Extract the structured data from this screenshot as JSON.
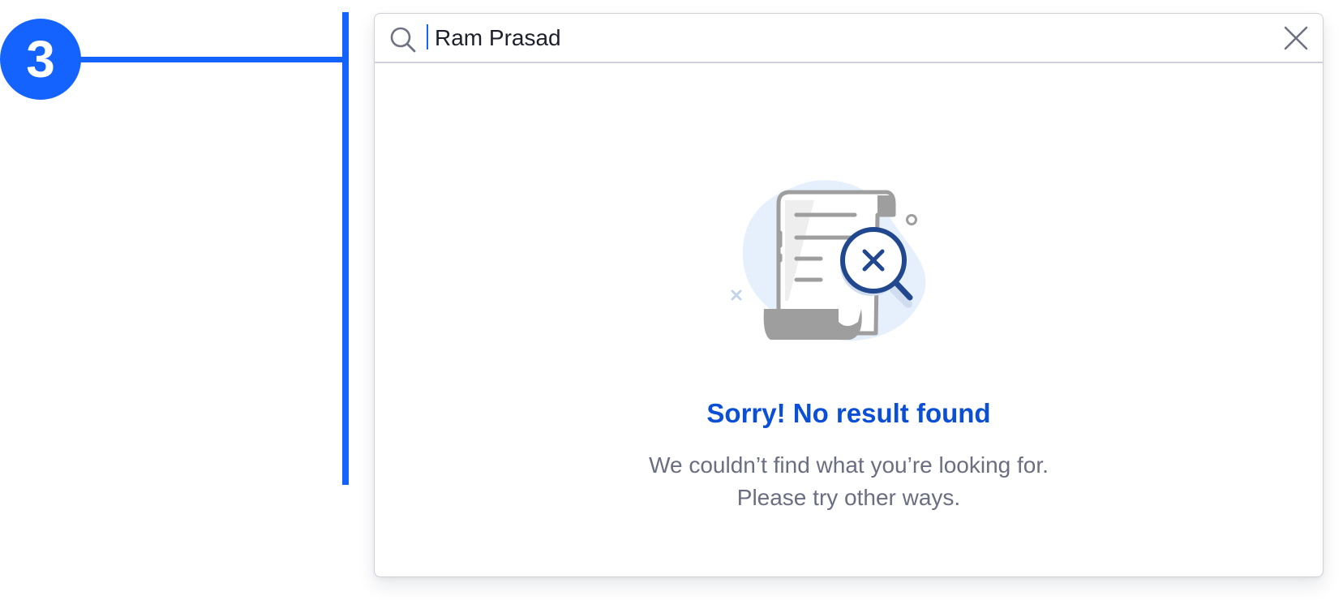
{
  "annotation": {
    "step_number": "3"
  },
  "search": {
    "value": "Ram Prasad",
    "search_icon": "search-icon",
    "clear_icon": "close-icon"
  },
  "empty_state": {
    "illustration": "document-search-no-result",
    "title": "Sorry! No result found",
    "description_line1": "We couldn’t find what you’re looking for.",
    "description_line2": "Please try other ways."
  },
  "colors": {
    "accent": "#1463ff",
    "title": "#0b4fd6",
    "text_muted": "#6b6e80",
    "border": "#cfd0d8",
    "illustration_blob": "#e6f0fd",
    "illustration_gray": "#9e9e9e",
    "magnifier": "#21488f"
  }
}
